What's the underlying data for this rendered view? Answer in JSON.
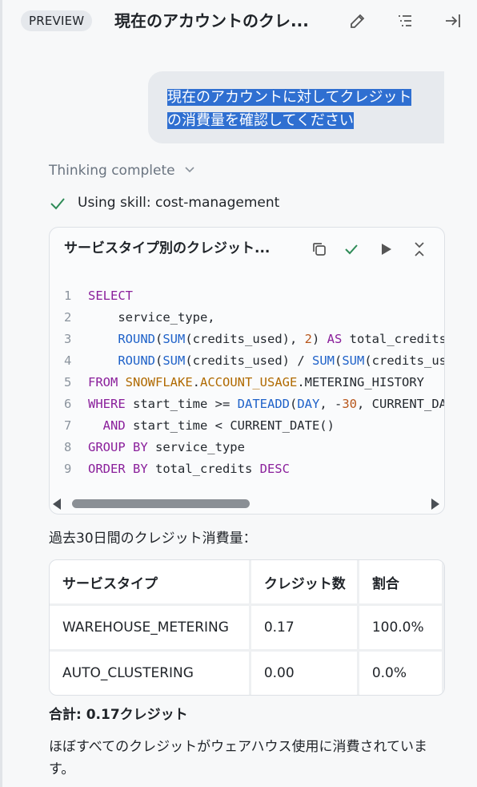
{
  "header": {
    "badge": "PREVIEW",
    "title": "現在のアカウントのクレ..."
  },
  "user_message": {
    "text": "現在のアカウントに対してクレジットの消費量を確認してください"
  },
  "thinking": {
    "label": "Thinking complete"
  },
  "skill": {
    "label": "Using skill: cost-management"
  },
  "code_block": {
    "title": "サービスタイプ別のクレジット...",
    "line_numbers": [
      "1",
      "2",
      "3",
      "4",
      "5",
      "6",
      "7",
      "8",
      "9"
    ]
  },
  "summary": {
    "heading": "過去30日間のクレジット消費量：",
    "columns": [
      "サービスタイプ",
      "クレジット数",
      "割合"
    ],
    "rows": [
      [
        "WAREHOUSE_METERING",
        "0.17",
        "100.0%"
      ],
      [
        "AUTO_CLUSTERING",
        "0.00",
        "0.0%"
      ]
    ],
    "total": "合計: 0.17クレジット",
    "description": "ほぼすべてのクレジットがウェアハウス使用に消費されています。"
  },
  "colors": {
    "accent_blue": "#2f6fd1",
    "check_green": "#2e8b57",
    "keyword": "#8a1f9b",
    "function": "#1f62c9"
  }
}
